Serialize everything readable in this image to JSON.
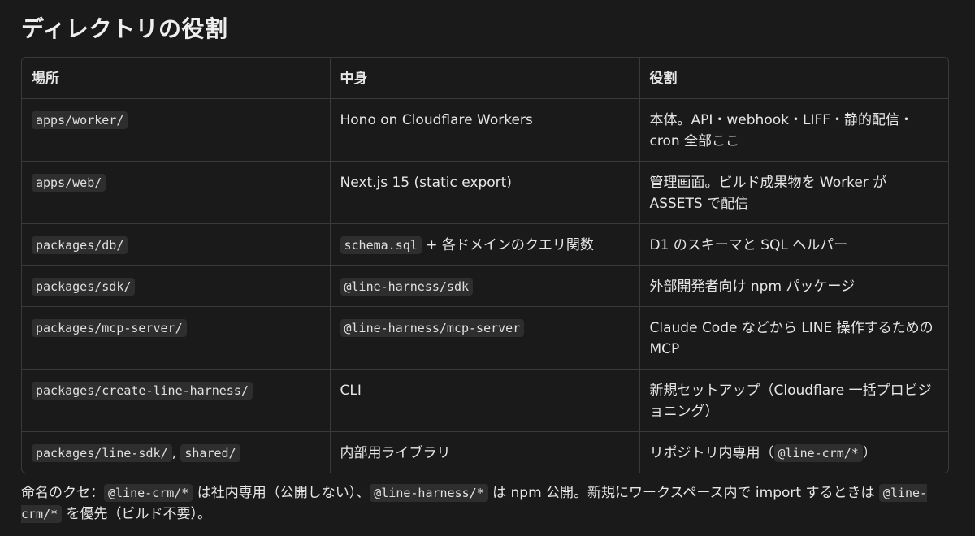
{
  "heading": "ディレクトリの役割",
  "table": {
    "headers": [
      "場所",
      "中身",
      "役割"
    ],
    "rows": [
      {
        "location": "apps/worker/",
        "contents": "Hono on Cloudflare Workers",
        "role": "本体。API・webhook・LIFF・静的配信・cron 全部ここ"
      },
      {
        "location": "apps/web/",
        "contents": "Next.js 15 (static export)",
        "role": "管理画面。ビルド成果物を Worker が ASSETS で配信"
      },
      {
        "location": "packages/db/",
        "contents_code": "schema.sql",
        "contents_text": " + 各ドメインのクエリ関数",
        "role": "D1 のスキーマと SQL ヘルパー"
      },
      {
        "location": "packages/sdk/",
        "contents_code": "@line-harness/sdk",
        "role": "外部開発者向け npm パッケージ"
      },
      {
        "location": "packages/mcp-server/",
        "contents_code": "@line-harness/mcp-server",
        "role": "Claude Code などから LINE 操作するための MCP"
      },
      {
        "location": "packages/create-line-harness/",
        "contents": "CLI",
        "role": "新規セットアップ（Cloudflare 一括プロビジョニング）"
      },
      {
        "location": "packages/line-sdk/",
        "location_sep": ", ",
        "location_2": "shared/",
        "contents": "内部用ライブラリ",
        "role_text": "リポジトリ内専用（",
        "role_code": "@line-crm/*",
        "role_end": "）"
      }
    ]
  },
  "note": {
    "t1": "命名のクセ：",
    "c1": "@line-crm/*",
    "t2": " は社内専用（公開しない）、",
    "c2": "@line-harness/*",
    "t3": " は npm 公開。新規にワークスペース内で import するときは ",
    "c3": "@line-crm/*",
    "t4": " を優先（ビルド不要）。"
  }
}
